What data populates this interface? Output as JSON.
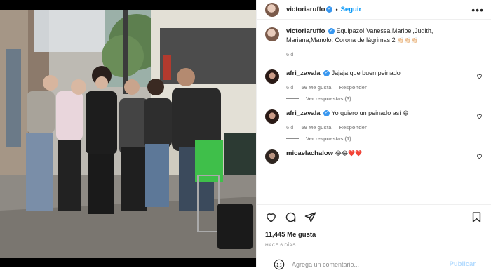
{
  "header": {
    "username": "victoriaruffo",
    "follow_label": "Seguir",
    "separator": "•",
    "more_icon": "more-horizontal-icon"
  },
  "caption": {
    "username": "victoriaruffo",
    "text": "Equipazo! Vanessa,Maribel,Judith, Mariana,Manolo. Corona de lágrimas 2",
    "emojis": "👏🏻👏🏻👏🏻",
    "time": "6 d"
  },
  "comments": [
    {
      "username": "afri_zavala",
      "text": "Jajaja que buen peinado",
      "time": "6 d",
      "likes": "56 Me gusta",
      "reply_label": "Responder",
      "view_replies": "Ver respuestas (3)"
    },
    {
      "username": "afri_zavala",
      "text": "Yo quiero un peinado así",
      "emoji": "😄",
      "time": "6 d",
      "likes": "59 Me gusta",
      "reply_label": "Responder",
      "view_replies": "Ver respuestas (1)"
    },
    {
      "username": "micaelachalow",
      "text": "",
      "emoji": "😂😂❤️❤️"
    }
  ],
  "actions": {
    "icons": [
      "heart-icon",
      "comment-icon",
      "share-icon",
      "bookmark-icon"
    ],
    "likes": "11,445 Me gusta",
    "posted_ago": "HACE 6 DÍAS"
  },
  "add_comment": {
    "placeholder": "Agrega un comentario...",
    "publish_label": "Publicar"
  },
  "colors": {
    "link_blue": "#0095f6",
    "verified_blue": "#3897f0",
    "muted_gray": "#8e8e8e",
    "publish_disabled": "#b3dbff"
  }
}
